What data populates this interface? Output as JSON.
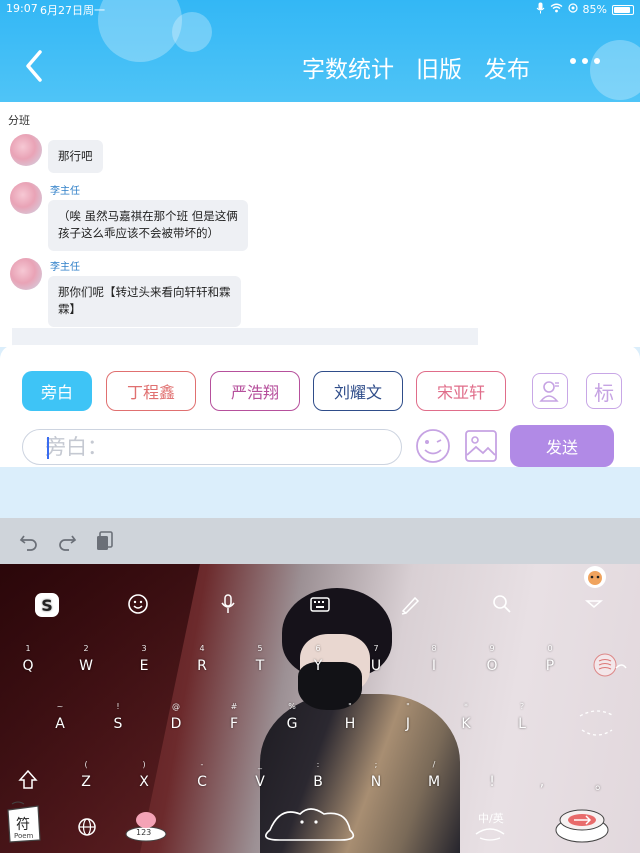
{
  "status_bar": {
    "time": "19:07",
    "date": "6月27日周一",
    "battery": "85%"
  },
  "header": {
    "actions": [
      "字数统计",
      "旧版",
      "发布"
    ]
  },
  "chat": {
    "group_label": "分班",
    "messages": [
      {
        "sender": "",
        "text": "那行吧"
      },
      {
        "sender": "李主任",
        "text_lines": [
          "（唉 虽然马嘉祺在那个班 但是这俩",
          "孩子这么乖应该不会被带坏的）"
        ]
      },
      {
        "sender": "李主任",
        "text_lines": [
          "那你们呢【转过头来看向轩轩和霖",
          "霖】"
        ]
      }
    ]
  },
  "composer": {
    "roles": [
      {
        "label": "旁白",
        "color": "#3ec4f6",
        "active": true
      },
      {
        "label": "丁程鑫",
        "color": "#e07070",
        "active": false
      },
      {
        "label": "严浩翔",
        "color": "#b6509c",
        "active": false
      },
      {
        "label": "刘耀文",
        "color": "#2f4d8a",
        "active": false
      },
      {
        "label": "宋亚轩",
        "color": "#e06d8a",
        "active": false
      }
    ],
    "tag_icon_label": "标",
    "input": {
      "placeholder": "旁白：",
      "value": ""
    },
    "send_label": "发送"
  },
  "keyboard": {
    "row1": [
      {
        "main": "Q",
        "sub": "1"
      },
      {
        "main": "W",
        "sub": "2"
      },
      {
        "main": "E",
        "sub": "3"
      },
      {
        "main": "R",
        "sub": "4"
      },
      {
        "main": "T",
        "sub": "5"
      },
      {
        "main": "Y",
        "sub": "6"
      },
      {
        "main": "U",
        "sub": "7"
      },
      {
        "main": "I",
        "sub": "8"
      },
      {
        "main": "O",
        "sub": "9"
      },
      {
        "main": "P",
        "sub": "0"
      }
    ],
    "row2": [
      {
        "main": "A",
        "sub": "~"
      },
      {
        "main": "S",
        "sub": "!"
      },
      {
        "main": "D",
        "sub": "@"
      },
      {
        "main": "F",
        "sub": "#"
      },
      {
        "main": "G",
        "sub": "%"
      },
      {
        "main": "H",
        "sub": "\""
      },
      {
        "main": "J",
        "sub": "\""
      },
      {
        "main": "K",
        "sub": "*"
      },
      {
        "main": "L",
        "sub": "?"
      }
    ],
    "row3": [
      {
        "main": "Z",
        "sub": "("
      },
      {
        "main": "X",
        "sub": ")"
      },
      {
        "main": "C",
        "sub": "-"
      },
      {
        "main": "V",
        "sub": "_"
      },
      {
        "main": "B",
        "sub": ":"
      },
      {
        "main": "N",
        "sub": ";"
      },
      {
        "main": "M",
        "sub": "/"
      },
      {
        "main": "!",
        "sub": ""
      },
      {
        "main": ",",
        "sub": ""
      },
      {
        "main": "。",
        "sub": ""
      }
    ],
    "symbol_key": "符",
    "symbol_sub": "Poem",
    "num_key": "123",
    "lang_key": "中/英"
  }
}
